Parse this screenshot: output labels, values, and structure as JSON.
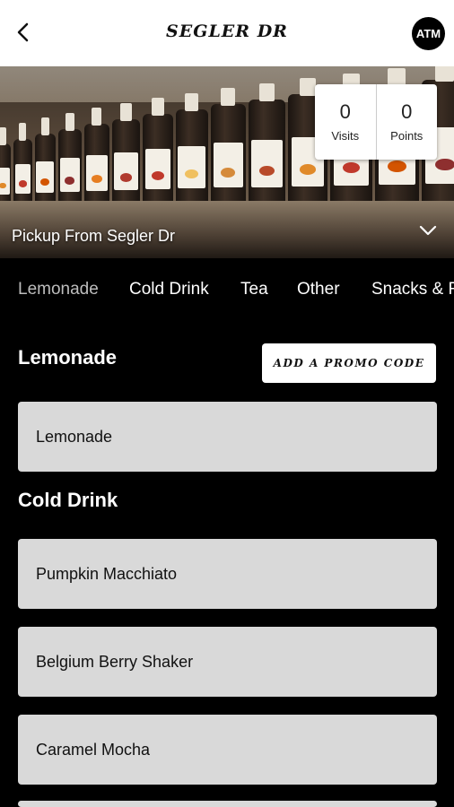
{
  "header": {
    "brand": "SEGLER DR",
    "avatar_text": "ATM"
  },
  "hero": {
    "pickup_text": "Pickup From Segler Dr",
    "stats": [
      {
        "value": "0",
        "caption": "Visits"
      },
      {
        "value": "0",
        "caption": "Points"
      }
    ]
  },
  "tabs": [
    "Lemonade",
    "Cold Drink",
    "Tea",
    "Other",
    "Snacks & F"
  ],
  "promo_label": "ADD A PROMO CODE",
  "sections": [
    {
      "title": "Lemonade",
      "items": [
        "Lemonade"
      ]
    },
    {
      "title": "Cold Drink",
      "items": [
        "Pumpkin Macchiato",
        "Belgium Berry Shaker",
        "Caramel Mocha"
      ]
    }
  ],
  "colors": {
    "background": "#000000",
    "card": "#d9d9d9",
    "active_tab": "#bdbdbd"
  }
}
